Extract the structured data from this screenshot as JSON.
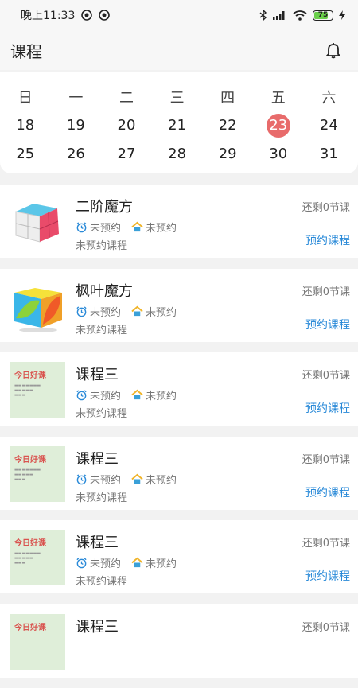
{
  "status_bar": {
    "time": "晚上11:33",
    "battery": "75"
  },
  "header": {
    "title": "课程"
  },
  "calendar": {
    "weekdays": [
      "日",
      "一",
      "二",
      "三",
      "四",
      "五",
      "六"
    ],
    "weeks": [
      [
        "18",
        "19",
        "20",
        "21",
        "22",
        "23",
        "24"
      ],
      [
        "25",
        "26",
        "27",
        "28",
        "29",
        "30",
        "31"
      ]
    ],
    "selected": "23"
  },
  "courses": [
    {
      "name": "二阶魔方",
      "clock_label": "未预约",
      "home_label": "未预约",
      "sub": "未预约课程",
      "remaining": "还剩0节课",
      "action": "预约课程"
    },
    {
      "name": "枫叶魔方",
      "clock_label": "未预约",
      "home_label": "未预约",
      "sub": "未预约课程",
      "remaining": "还剩0节课",
      "action": "预约课程"
    },
    {
      "name": "课程三",
      "clock_label": "未预约",
      "home_label": "未预约",
      "sub": "未预约课程",
      "remaining": "还剩0节课",
      "action": "预约课程",
      "thumb_text": "今日好课"
    },
    {
      "name": "课程三",
      "clock_label": "未预约",
      "home_label": "未预约",
      "sub": "未预约课程",
      "remaining": "还剩0节课",
      "action": "预约课程",
      "thumb_text": "今日好课"
    },
    {
      "name": "课程三",
      "clock_label": "未预约",
      "home_label": "未预约",
      "sub": "未预约课程",
      "remaining": "还剩0节课",
      "action": "预约课程",
      "thumb_text": "今日好课"
    },
    {
      "name": "课程三",
      "remaining": "还剩0节课",
      "thumb_text": "今日好课"
    }
  ],
  "colors": {
    "accent": "#2a8ad8",
    "selected_day": "#e86b6b",
    "thumb_bg": "#dfeed9"
  }
}
